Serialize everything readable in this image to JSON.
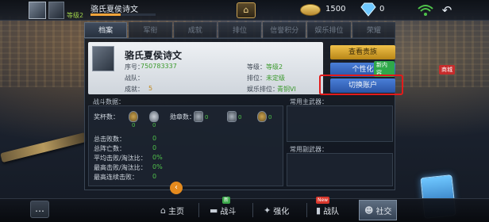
{
  "topbar": {
    "player_name": "骆氏夏侯诗文",
    "level_label": "等级2",
    "xp_progress": 0.46,
    "currency_coins": "1500",
    "currency_gems": "0",
    "chest_label": "⌂",
    "back_glyph": "↶",
    "icons": [
      "avatar-icon",
      "rank-icon",
      "chest-icon",
      "coin-icon",
      "diamond-icon",
      "wifi-icon",
      "back-icon"
    ]
  },
  "tabs": [
    {
      "label": "档案",
      "active": true
    },
    {
      "label": "军衔",
      "active": false
    },
    {
      "label": "成就",
      "active": false
    },
    {
      "label": "排位",
      "active": false
    },
    {
      "label": "信誉积分",
      "active": false
    },
    {
      "label": "娱乐排位",
      "active": false
    },
    {
      "label": "荣耀",
      "active": false
    }
  ],
  "profile": {
    "name": "骆氏夏侯诗文",
    "id_label": "序号：",
    "id_value": "750783337",
    "team_label": "战队：",
    "team_value": "",
    "achievement_label": "成就：",
    "achievement_value": "5",
    "level_label": "等级：",
    "level_value": "等级2",
    "rank_label": "排位：",
    "rank_value": "未定级",
    "fun_rank_label": "娱乐排位：",
    "fun_rank_value": "青铜VI"
  },
  "buttons": {
    "view_honor": "查看贵族",
    "personalize": "个性化",
    "new_badge": "新内容",
    "switch_account": "切换账户"
  },
  "stats": {
    "title": "战斗数据：",
    "trophy_label": "奖杯数：",
    "medal_label": "勋章数：",
    "trophy_counts": [
      "0",
      "0"
    ],
    "medal_counts": [
      "0",
      "0",
      "0"
    ],
    "rows": [
      {
        "label": "总击败数：",
        "value": "0"
      },
      {
        "label": "总阵亡数：",
        "value": "0"
      },
      {
        "label": "平均击败/淘汰比：",
        "value": "0%"
      },
      {
        "label": "最高击败/淘汰比：",
        "value": "0%"
      },
      {
        "label": "最高连续击败：",
        "value": "0"
      }
    ]
  },
  "weapons": {
    "main_title": "常用主武器：",
    "secondary_title": "常用副武器："
  },
  "side_tag": "商城",
  "bottom_nav": [
    {
      "label": "主页",
      "icon": "⌂",
      "badge": "",
      "active": false
    },
    {
      "label": "战斗",
      "icon": "▬",
      "badge": "新",
      "active": false
    },
    {
      "label": "强化",
      "icon": "✦",
      "badge": "",
      "active": false
    },
    {
      "label": "战队",
      "icon": "▮",
      "badge": "New",
      "active": false
    },
    {
      "label": "社交",
      "icon": "☻",
      "badge": "",
      "active": true
    }
  ],
  "colors": {
    "accent_green": "#4fc24a",
    "highlight_red": "#e21b1b",
    "button_blue": "#2a54a6",
    "button_yellow": "#f0c14a"
  }
}
